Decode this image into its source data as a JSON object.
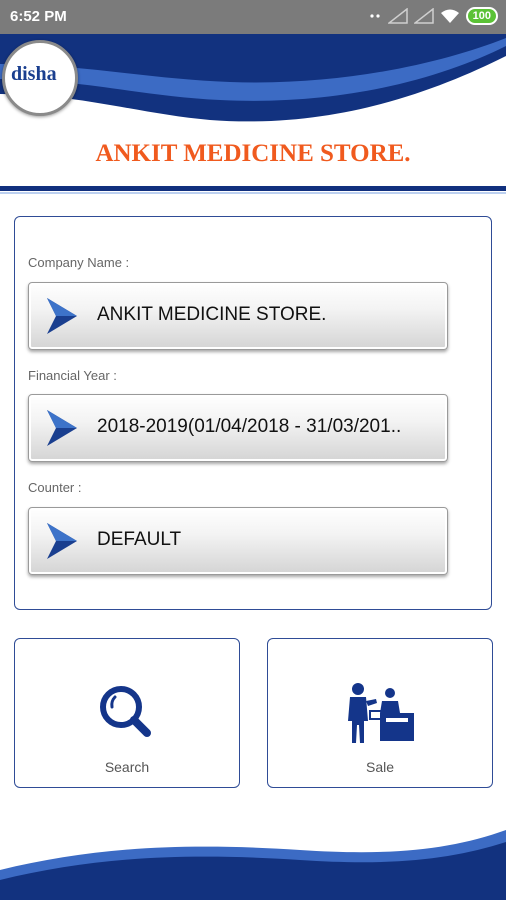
{
  "status_bar": {
    "time": "6:52 PM",
    "battery": "100"
  },
  "header": {
    "logo_text": "disha",
    "store_name": "ANKIT MEDICINE STORE."
  },
  "form": {
    "company": {
      "label": "Company Name :",
      "value": "ANKIT MEDICINE STORE."
    },
    "financial_year": {
      "label": "Financial Year :",
      "value": "2018-2019(01/04/2018 - 31/03/201.."
    },
    "counter": {
      "label": "Counter :",
      "value": "DEFAULT"
    }
  },
  "tiles": {
    "search": {
      "label": "Search",
      "icon": "search-icon"
    },
    "sale": {
      "label": "Sale",
      "icon": "cashier-icon"
    }
  },
  "colors": {
    "brand_blue": "#11307e",
    "title_orange": "#f05a1e",
    "border_blue": "#2f4c96"
  }
}
